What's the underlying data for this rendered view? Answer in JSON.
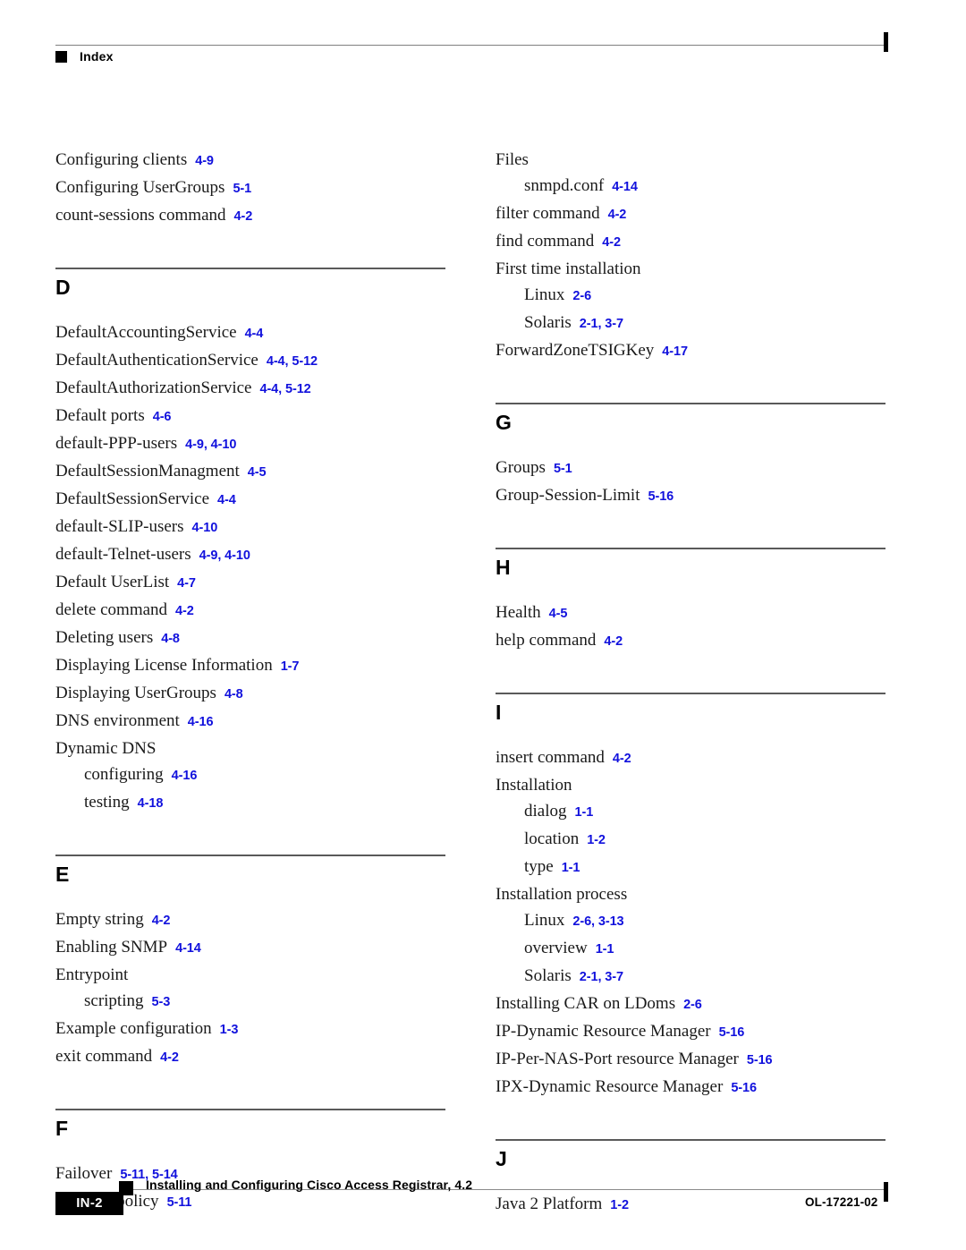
{
  "header": {
    "title": "Index",
    "bullet_icon": "black-square-icon"
  },
  "columns": {
    "left": [
      {
        "letter": null,
        "show_rule": false,
        "entries": [
          {
            "term": "Configuring clients",
            "refs": "4-9",
            "level": 0
          },
          {
            "term": "Configuring UserGroups",
            "refs": "5-1",
            "level": 0
          },
          {
            "term": "count-sessions command",
            "refs": "4-2",
            "level": 0
          }
        ]
      },
      {
        "letter": "D",
        "show_rule": true,
        "entries": [
          {
            "term": "DefaultAccountingService",
            "refs": "4-4",
            "level": 0
          },
          {
            "term": "DefaultAuthenticationService",
            "refs": "4-4, 5-12",
            "level": 0
          },
          {
            "term": "DefaultAuthorizationService",
            "refs": "4-4, 5-12",
            "level": 0
          },
          {
            "term": "Default ports",
            "refs": "4-6",
            "level": 0
          },
          {
            "term": "default-PPP-users",
            "refs": "4-9, 4-10",
            "level": 0
          },
          {
            "term": "DefaultSessionManagment",
            "refs": "4-5",
            "level": 0
          },
          {
            "term": "DefaultSessionService",
            "refs": "4-4",
            "level": 0
          },
          {
            "term": "default-SLIP-users",
            "refs": "4-10",
            "level": 0
          },
          {
            "term": "default-Telnet-users",
            "refs": "4-9, 4-10",
            "level": 0
          },
          {
            "term": "Default UserList",
            "refs": "4-7",
            "level": 0
          },
          {
            "term": "delete command",
            "refs": "4-2",
            "level": 0
          },
          {
            "term": "Deleting users",
            "refs": "4-8",
            "level": 0
          },
          {
            "term": "Displaying License Information",
            "refs": "1-7",
            "level": 0
          },
          {
            "term": "Displaying UserGroups",
            "refs": "4-8",
            "level": 0
          },
          {
            "term": "DNS environment",
            "refs": "4-16",
            "level": 0
          },
          {
            "term": "Dynamic DNS",
            "refs": "",
            "level": 0
          },
          {
            "term": "configuring",
            "refs": "4-16",
            "level": 1
          },
          {
            "term": "testing",
            "refs": "4-18",
            "level": 1
          }
        ]
      },
      {
        "letter": "E",
        "show_rule": true,
        "entries": [
          {
            "term": "Empty string",
            "refs": "4-2",
            "level": 0
          },
          {
            "term": "Enabling SNMP",
            "refs": "4-14",
            "level": 0
          },
          {
            "term": "Entrypoint",
            "refs": "",
            "level": 0
          },
          {
            "term": "scripting",
            "refs": "5-3",
            "level": 1
          },
          {
            "term": "Example configuration",
            "refs": "1-3",
            "level": 0
          },
          {
            "term": "exit command",
            "refs": "4-2",
            "level": 0
          }
        ]
      },
      {
        "letter": "F",
        "show_rule": true,
        "entries": [
          {
            "term": "Failover",
            "refs": "5-11, 5-14",
            "level": 0
          },
          {
            "term": "Failover policy",
            "refs": "5-11",
            "level": 0
          }
        ]
      }
    ],
    "right": [
      {
        "letter": null,
        "show_rule": false,
        "entries": [
          {
            "term": "Files",
            "refs": "",
            "level": 0
          },
          {
            "term": "snmpd.conf",
            "refs": "4-14",
            "level": 1
          },
          {
            "term": "filter command",
            "refs": "4-2",
            "level": 0
          },
          {
            "term": "find command",
            "refs": "4-2",
            "level": 0
          },
          {
            "term": "First time installation",
            "refs": "",
            "level": 0
          },
          {
            "term": "Linux",
            "refs": "2-6",
            "level": 1
          },
          {
            "term": "Solaris",
            "refs": "2-1, 3-7",
            "level": 1
          },
          {
            "term": "ForwardZoneTSIGKey",
            "refs": "4-17",
            "level": 0
          }
        ]
      },
      {
        "letter": "G",
        "show_rule": true,
        "entries": [
          {
            "term": "Groups",
            "refs": "5-1",
            "level": 0
          },
          {
            "term": "Group-Session-Limit",
            "refs": "5-16",
            "level": 0
          }
        ]
      },
      {
        "letter": "H",
        "show_rule": true,
        "entries": [
          {
            "term": "Health",
            "refs": "4-5",
            "level": 0
          },
          {
            "term": "help command",
            "refs": "4-2",
            "level": 0
          }
        ]
      },
      {
        "letter": "I",
        "show_rule": true,
        "entries": [
          {
            "term": "insert command",
            "refs": "4-2",
            "level": 0
          },
          {
            "term": "Installation",
            "refs": "",
            "level": 0
          },
          {
            "term": "dialog",
            "refs": "1-1",
            "level": 1
          },
          {
            "term": "location",
            "refs": "1-2",
            "level": 1
          },
          {
            "term": "type",
            "refs": "1-1",
            "level": 1
          },
          {
            "term": "Installation process",
            "refs": "",
            "level": 0
          },
          {
            "term": "Linux",
            "refs": "2-6, 3-13",
            "level": 1
          },
          {
            "term": "overview",
            "refs": "1-1",
            "level": 1
          },
          {
            "term": "Solaris",
            "refs": "2-1, 3-7",
            "level": 1
          },
          {
            "term": "Installing CAR on LDoms",
            "refs": "2-6",
            "level": 0
          },
          {
            "term": "IP-Dynamic Resource Manager",
            "refs": "5-16",
            "level": 0
          },
          {
            "term": "IP-Per-NAS-Port resource Manager",
            "refs": "5-16",
            "level": 0
          },
          {
            "term": "IPX-Dynamic Resource Manager",
            "refs": "5-16",
            "level": 0
          }
        ]
      },
      {
        "letter": "J",
        "show_rule": true,
        "entries": [
          {
            "term": "Java 2 Platform",
            "refs": "1-2",
            "level": 0
          }
        ]
      }
    ]
  },
  "footer": {
    "page_number": "IN-2",
    "document_title": "Installing and Configuring Cisco Access Registrar, 4.2",
    "document_number": "OL-17221-02",
    "bullet_icon": "black-square-icon"
  },
  "colors": {
    "reference_blue": "#1111dd",
    "rule_gray": "#5a5a5a",
    "text_black": "#1a1a1a"
  }
}
